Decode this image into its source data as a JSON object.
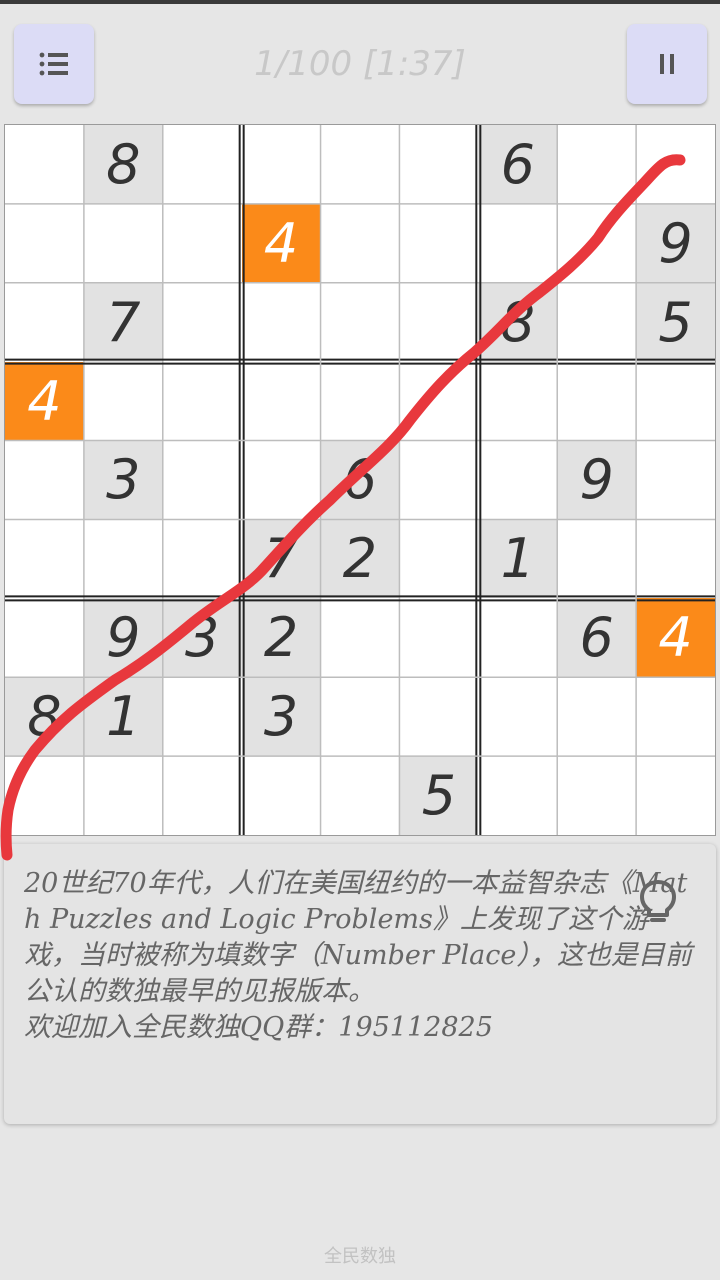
{
  "header": {
    "title": "1/100 [1:37]",
    "menu_icon": "menu-icon",
    "pause_icon": "pause-icon"
  },
  "board": {
    "cells": [
      [
        "",
        "8",
        "",
        "",
        "",
        "",
        "6",
        "",
        ""
      ],
      [
        "",
        "",
        "",
        "4",
        "",
        "",
        "",
        "",
        "9"
      ],
      [
        "",
        "7",
        "",
        "",
        "",
        "",
        "8",
        "",
        "5"
      ],
      [
        "4",
        "",
        "",
        "",
        "",
        "",
        "",
        "",
        ""
      ],
      [
        "",
        "3",
        "",
        "",
        "6",
        "",
        "",
        "9",
        ""
      ],
      [
        "",
        "",
        "",
        "7",
        "2",
        "",
        "1",
        "",
        ""
      ],
      [
        "",
        "9",
        "3",
        "2",
        "",
        "",
        "",
        "6",
        "4"
      ],
      [
        "8",
        "1",
        "",
        "3",
        "",
        "",
        "",
        "",
        ""
      ],
      [
        "",
        "",
        "",
        "",
        "",
        "5",
        "",
        "",
        ""
      ]
    ],
    "given": [
      [
        0,
        1
      ],
      [
        0,
        6
      ],
      [
        1,
        8
      ],
      [
        2,
        1
      ],
      [
        2,
        6
      ],
      [
        2,
        8
      ],
      [
        4,
        1
      ],
      [
        4,
        4
      ],
      [
        4,
        7
      ],
      [
        5,
        3
      ],
      [
        5,
        4
      ],
      [
        5,
        6
      ],
      [
        6,
        1
      ],
      [
        6,
        2
      ],
      [
        6,
        3
      ],
      [
        6,
        7
      ],
      [
        7,
        0
      ],
      [
        7,
        1
      ],
      [
        7,
        3
      ],
      [
        8,
        5
      ]
    ],
    "highlighted": [
      [
        1,
        3
      ],
      [
        3,
        0
      ],
      [
        6,
        8
      ]
    ],
    "highlight_color": "#fb8a19",
    "given_color": "#e2e2e2"
  },
  "info": {
    "text": "20世纪70年代，人们在美国纽约的一本益智杂志《Math Puzzles and Logic Problems》上发现了这个游戏，当时被称为填数字（Number Place），这也是目前公认的数独最早的见报版本。\n欢迎加入全民数独QQ群：195112825",
    "hint_icon": "lightbulb-icon"
  },
  "footer": {
    "label": "全民数独"
  },
  "annotation": {
    "stroke_color": "#e8383d"
  }
}
